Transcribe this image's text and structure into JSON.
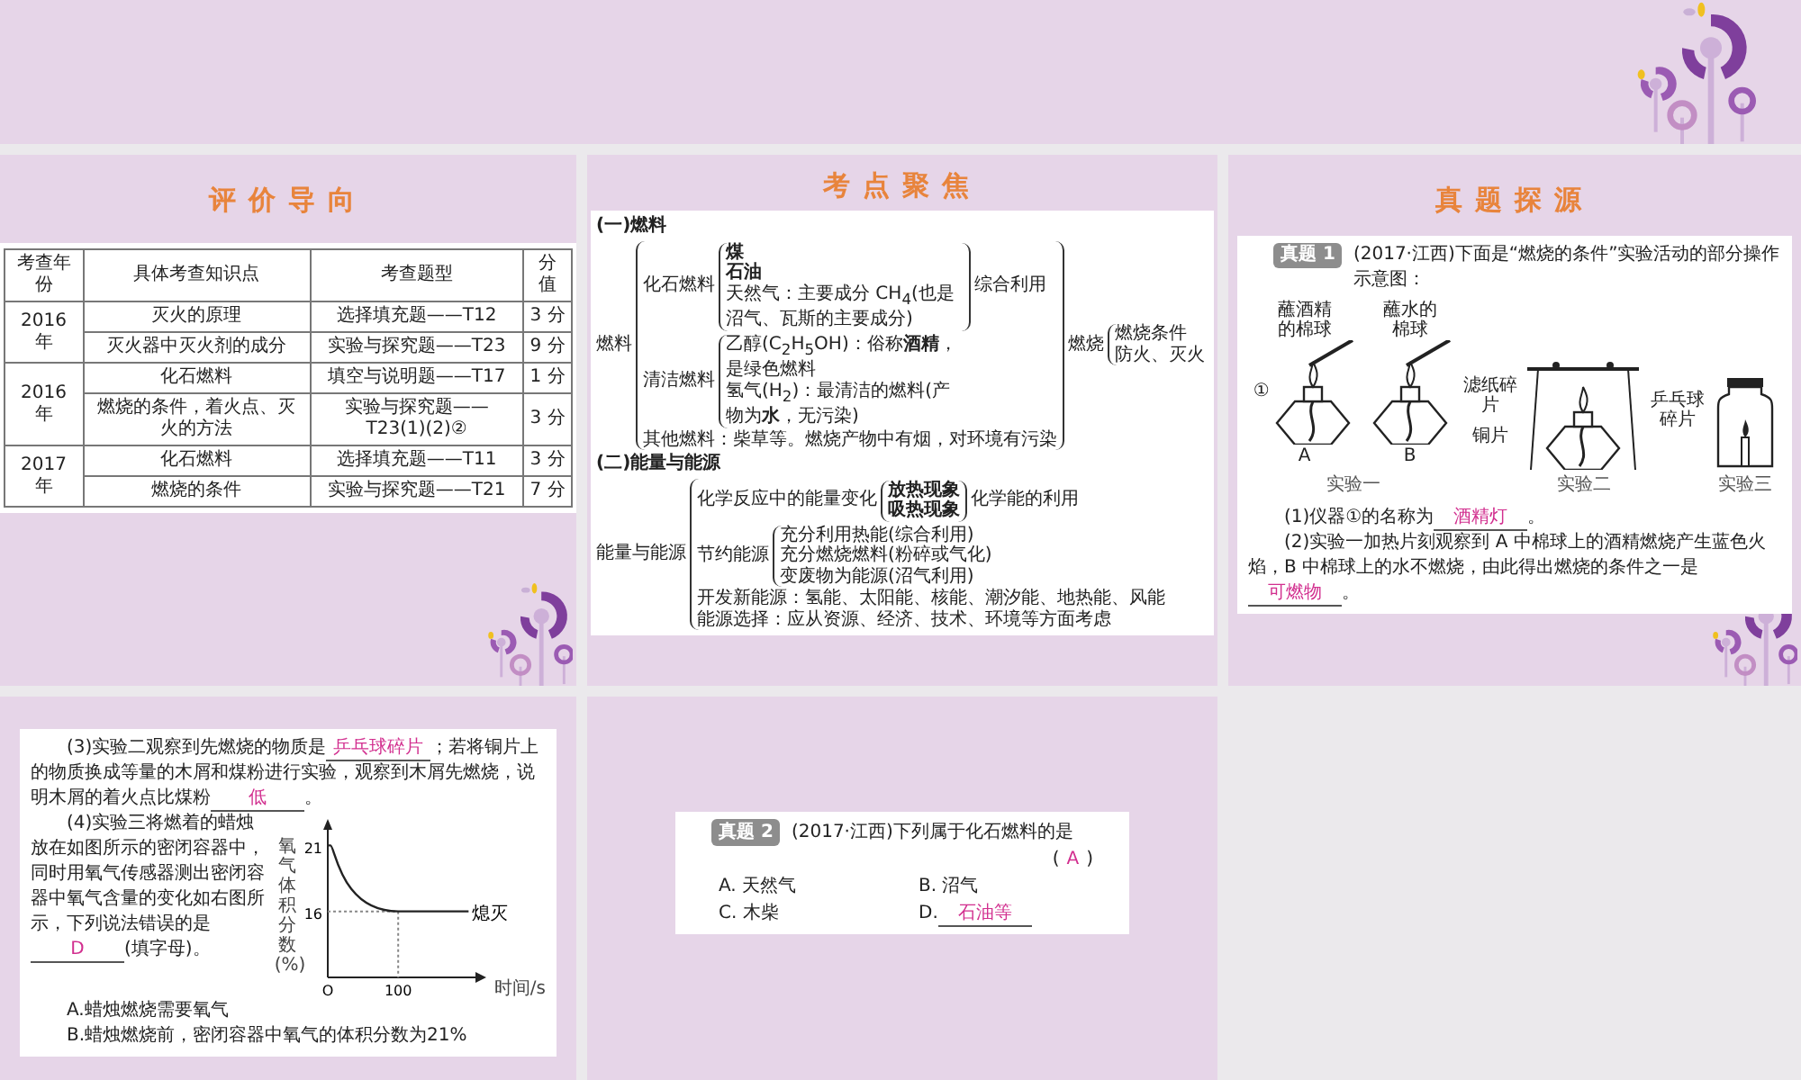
{
  "evaluation": {
    "title": "评价导向",
    "columns": [
      "考查年份",
      "具体考查知识点",
      "考查题型",
      "分值"
    ],
    "groups": [
      {
        "year": "2016 年",
        "rows": [
          {
            "point": "灭火的原理",
            "type": "选择填充题——T12",
            "score": "3 分"
          },
          {
            "point": "灭火器中灭火剂的成分",
            "type": "实验与探究题——T23",
            "score": "9 分"
          }
        ]
      },
      {
        "year": "2016 年",
        "rows": [
          {
            "point": "化石燃料",
            "type": "填空与说明题——T17",
            "score": "1 分"
          },
          {
            "point": "燃烧的条件，着火点、灭火的方法",
            "type": "实验与探究题——T23(1)(2)②",
            "score": "3 分"
          }
        ]
      },
      {
        "year": "2017 年",
        "rows": [
          {
            "point": "化石燃料",
            "type": "选择填充题——T11",
            "score": "3 分"
          },
          {
            "point": "燃烧的条件",
            "type": "实验与探究题——T21",
            "score": "7 分"
          }
        ]
      }
    ]
  },
  "focus": {
    "title": "考点聚焦",
    "sections": [
      {
        "heading": "(一)燃料",
        "tree": {
          "label": "燃料",
          "after": {
            "label": "燃烧",
            "children": [
              {
                "label": "燃烧条件"
              },
              {
                "label": "防火、灭火"
              }
            ]
          },
          "children": [
            {
              "label": "化石燃料",
              "after": {
                "label": "综合利用"
              },
              "children": [
                {
                  "label": "**煤**"
                },
                {
                  "label": "**石油**"
                },
                {
                  "label": "天然气：主要成分 CH$_{4}$(也是沼气、瓦斯的主要成分)"
                }
              ]
            },
            {
              "label": "清洁燃料",
              "children": [
                {
                  "label": "乙醇(C$_{2}$H$_{5}$OH)：俗称**酒精**，是绿色燃料"
                },
                {
                  "label": "氢气(H$_{2}$)：最清洁的燃料(产物为**水**，无污染)"
                }
              ]
            },
            {
              "label": "其他燃料：柴草等。燃烧产物中有烟，对环境有污染"
            }
          ]
        }
      },
      {
        "heading": "(二)能量与能源",
        "tree": {
          "label": "能量与能源",
          "children": [
            {
              "label": "化学反应中的能量变化",
              "after": {
                "label": "化学能的利用"
              },
              "children": [
                {
                  "label": "**放热现象**"
                },
                {
                  "label": "**吸热现象**"
                }
              ]
            },
            {
              "label": "节约能源",
              "children": [
                {
                  "label": "充分利用热能(综合利用)"
                },
                {
                  "label": "充分燃烧燃料(粉碎或气化)"
                },
                {
                  "label": "变废物为能源(沼气利用)"
                }
              ]
            },
            {
              "label": "开发新能源：氢能、太阳能、核能、潮汐能、地热能、风能"
            },
            {
              "label": "能源选择：应从资源、经济、技术、环境等方面考虑"
            }
          ]
        }
      }
    ]
  },
  "source": {
    "title": "真题探源",
    "tag": "真题 1",
    "stem": "(2017·江西)下面是“燃烧的条件”实验活动的部分操作示意图：",
    "experiments": [
      {
        "kind": "lamps",
        "caption": "实验一",
        "lamps": [
          {
            "label": "蘸酒精的棉球",
            "marker": "①",
            "letter": "A"
          },
          {
            "label": "蘸水的棉球",
            "letter": "B"
          }
        ]
      },
      {
        "kind": "plate",
        "caption": "实验二",
        "labels_left": [
          "滤纸碎片",
          "铜片"
        ],
        "label_right": "乒乓球碎片"
      },
      {
        "kind": "jar",
        "caption": "实验三"
      }
    ],
    "parts": [
      [
        {
          "text": "(1)仪器①的名称为"
        },
        {
          "answer": "酒精灯"
        },
        {
          "text": "。"
        }
      ],
      [
        {
          "text": "(2)实验一加热片刻观察到 A 中棉球上的酒精燃烧产生蓝色火焰，B 中棉球上的水不燃烧，由此得出燃烧的条件之一是"
        },
        {
          "answer": "可燃物"
        },
        {
          "text": "。"
        }
      ]
    ]
  },
  "continued": {
    "parts": [
      [
        {
          "text": "(3)实验二观察到先燃烧的物质是"
        },
        {
          "answer": "乒乓球碎片"
        },
        {
          "text": "；若将铜片上的物质换成等量的木屑和煤粉进行实验，观察到木屑先燃烧，说明木屑的着火点比煤粉"
        },
        {
          "answer": "低"
        },
        {
          "text": "。"
        }
      ]
    ],
    "part4": [
      {
        "text": "(4)实验三将燃着的蜡烛放在如图所示的密闭容器中，同时用氧气传感器测出密闭容器中氧气含量的变化如右图所示，下列说法错误的是"
      },
      {
        "answer": "D"
      },
      {
        "text": "(填字母)。"
      }
    ],
    "chart_data": {
      "type": "line",
      "ylabel": "氧气体积分数(%)",
      "xlabel": "时间/s",
      "categories": [
        "O",
        "100",
        null
      ],
      "series": [
        {
          "values": [
            21,
            16,
            16
          ]
        }
      ],
      "yticks": [
        16,
        21
      ],
      "ylim": [
        11,
        23
      ],
      "annotations": [
        {
          "text": "熄灭"
        }
      ]
    },
    "options": [
      "A.蜡烛燃烧需要氧气",
      "B.蜡烛燃烧前，密闭容器中氧气的体积分数为21%"
    ]
  },
  "question2": {
    "tag": "真题 2",
    "stem": "(2017·江西)下列属于化石燃料的是",
    "answer_open": "(",
    "answer": "A",
    "answer_close": ")",
    "options": [
      {
        "text": "A. 天然气"
      },
      {
        "text": "B. 沼气"
      },
      {
        "text": "C. 木柴"
      },
      {
        "text": "D.",
        "answer": "石油等"
      }
    ]
  }
}
